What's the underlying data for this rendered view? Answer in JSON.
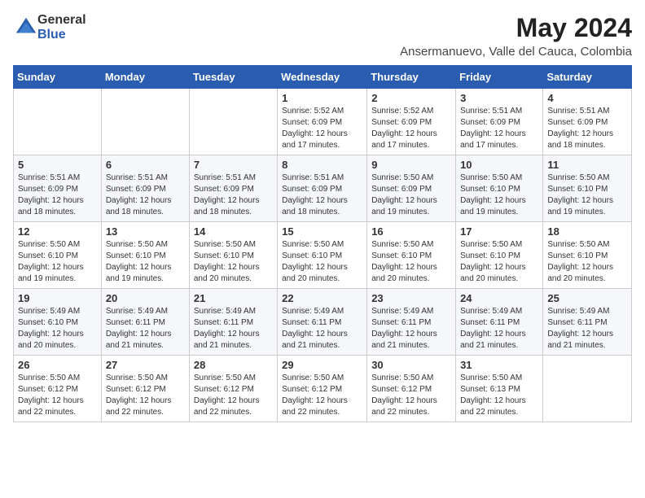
{
  "logo": {
    "general": "General",
    "blue": "Blue"
  },
  "header": {
    "month_year": "May 2024",
    "location": "Ansermanuevo, Valle del Cauca, Colombia"
  },
  "weekdays": [
    "Sunday",
    "Monday",
    "Tuesday",
    "Wednesday",
    "Thursday",
    "Friday",
    "Saturday"
  ],
  "weeks": [
    [
      {
        "day": "",
        "info": ""
      },
      {
        "day": "",
        "info": ""
      },
      {
        "day": "",
        "info": ""
      },
      {
        "day": "1",
        "info": "Sunrise: 5:52 AM\nSunset: 6:09 PM\nDaylight: 12 hours\nand 17 minutes."
      },
      {
        "day": "2",
        "info": "Sunrise: 5:52 AM\nSunset: 6:09 PM\nDaylight: 12 hours\nand 17 minutes."
      },
      {
        "day": "3",
        "info": "Sunrise: 5:51 AM\nSunset: 6:09 PM\nDaylight: 12 hours\nand 17 minutes."
      },
      {
        "day": "4",
        "info": "Sunrise: 5:51 AM\nSunset: 6:09 PM\nDaylight: 12 hours\nand 18 minutes."
      }
    ],
    [
      {
        "day": "5",
        "info": "Sunrise: 5:51 AM\nSunset: 6:09 PM\nDaylight: 12 hours\nand 18 minutes."
      },
      {
        "day": "6",
        "info": "Sunrise: 5:51 AM\nSunset: 6:09 PM\nDaylight: 12 hours\nand 18 minutes."
      },
      {
        "day": "7",
        "info": "Sunrise: 5:51 AM\nSunset: 6:09 PM\nDaylight: 12 hours\nand 18 minutes."
      },
      {
        "day": "8",
        "info": "Sunrise: 5:51 AM\nSunset: 6:09 PM\nDaylight: 12 hours\nand 18 minutes."
      },
      {
        "day": "9",
        "info": "Sunrise: 5:50 AM\nSunset: 6:09 PM\nDaylight: 12 hours\nand 19 minutes."
      },
      {
        "day": "10",
        "info": "Sunrise: 5:50 AM\nSunset: 6:10 PM\nDaylight: 12 hours\nand 19 minutes."
      },
      {
        "day": "11",
        "info": "Sunrise: 5:50 AM\nSunset: 6:10 PM\nDaylight: 12 hours\nand 19 minutes."
      }
    ],
    [
      {
        "day": "12",
        "info": "Sunrise: 5:50 AM\nSunset: 6:10 PM\nDaylight: 12 hours\nand 19 minutes."
      },
      {
        "day": "13",
        "info": "Sunrise: 5:50 AM\nSunset: 6:10 PM\nDaylight: 12 hours\nand 19 minutes."
      },
      {
        "day": "14",
        "info": "Sunrise: 5:50 AM\nSunset: 6:10 PM\nDaylight: 12 hours\nand 20 minutes."
      },
      {
        "day": "15",
        "info": "Sunrise: 5:50 AM\nSunset: 6:10 PM\nDaylight: 12 hours\nand 20 minutes."
      },
      {
        "day": "16",
        "info": "Sunrise: 5:50 AM\nSunset: 6:10 PM\nDaylight: 12 hours\nand 20 minutes."
      },
      {
        "day": "17",
        "info": "Sunrise: 5:50 AM\nSunset: 6:10 PM\nDaylight: 12 hours\nand 20 minutes."
      },
      {
        "day": "18",
        "info": "Sunrise: 5:50 AM\nSunset: 6:10 PM\nDaylight: 12 hours\nand 20 minutes."
      }
    ],
    [
      {
        "day": "19",
        "info": "Sunrise: 5:49 AM\nSunset: 6:10 PM\nDaylight: 12 hours\nand 20 minutes."
      },
      {
        "day": "20",
        "info": "Sunrise: 5:49 AM\nSunset: 6:11 PM\nDaylight: 12 hours\nand 21 minutes."
      },
      {
        "day": "21",
        "info": "Sunrise: 5:49 AM\nSunset: 6:11 PM\nDaylight: 12 hours\nand 21 minutes."
      },
      {
        "day": "22",
        "info": "Sunrise: 5:49 AM\nSunset: 6:11 PM\nDaylight: 12 hours\nand 21 minutes."
      },
      {
        "day": "23",
        "info": "Sunrise: 5:49 AM\nSunset: 6:11 PM\nDaylight: 12 hours\nand 21 minutes."
      },
      {
        "day": "24",
        "info": "Sunrise: 5:49 AM\nSunset: 6:11 PM\nDaylight: 12 hours\nand 21 minutes."
      },
      {
        "day": "25",
        "info": "Sunrise: 5:49 AM\nSunset: 6:11 PM\nDaylight: 12 hours\nand 21 minutes."
      }
    ],
    [
      {
        "day": "26",
        "info": "Sunrise: 5:50 AM\nSunset: 6:12 PM\nDaylight: 12 hours\nand 22 minutes."
      },
      {
        "day": "27",
        "info": "Sunrise: 5:50 AM\nSunset: 6:12 PM\nDaylight: 12 hours\nand 22 minutes."
      },
      {
        "day": "28",
        "info": "Sunrise: 5:50 AM\nSunset: 6:12 PM\nDaylight: 12 hours\nand 22 minutes."
      },
      {
        "day": "29",
        "info": "Sunrise: 5:50 AM\nSunset: 6:12 PM\nDaylight: 12 hours\nand 22 minutes."
      },
      {
        "day": "30",
        "info": "Sunrise: 5:50 AM\nSunset: 6:12 PM\nDaylight: 12 hours\nand 22 minutes."
      },
      {
        "day": "31",
        "info": "Sunrise: 5:50 AM\nSunset: 6:13 PM\nDaylight: 12 hours\nand 22 minutes."
      },
      {
        "day": "",
        "info": ""
      }
    ]
  ]
}
